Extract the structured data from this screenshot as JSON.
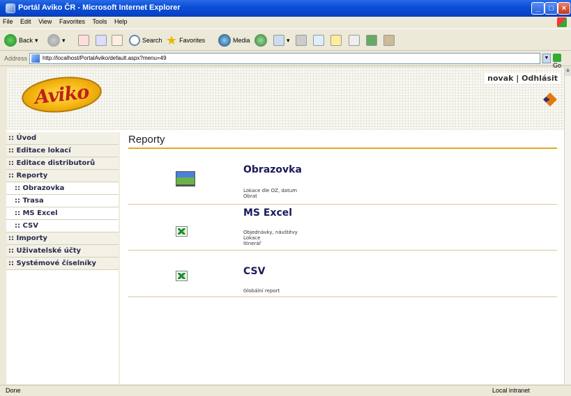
{
  "window": {
    "title": "Portál Aviko ČR - Microsoft Internet Explorer"
  },
  "menu": [
    "File",
    "Edit",
    "View",
    "Favorites",
    "Tools",
    "Help"
  ],
  "toolbar": {
    "back": "Back",
    "search": "Search",
    "favorites": "Favorites",
    "media": "Media"
  },
  "address": {
    "label": "Address",
    "url": "http://localhost/PortalAviko/default.aspx?menu=49",
    "go": "Go"
  },
  "header": {
    "logo_text": "Aviko",
    "user": "novak",
    "separator": "|",
    "logout": "Odhlásit"
  },
  "sidebar": {
    "items": [
      {
        "label": ":: Úvod"
      },
      {
        "label": ":: Editace lokací"
      },
      {
        "label": ":: Editace distributorů"
      },
      {
        "label": ":: Reporty"
      },
      {
        "label": ":: Obrazovka"
      },
      {
        "label": ":: Trasa"
      },
      {
        "label": ":: MS Excel"
      },
      {
        "label": ":: CSV"
      },
      {
        "label": ":: Importy"
      },
      {
        "label": ":: Uživatelské účty"
      },
      {
        "label": ":: Systémové číselníky"
      }
    ]
  },
  "main": {
    "title": "Reporty",
    "reports": [
      {
        "title": "Obrazovka",
        "lines": [
          "Lokace dle OZ, datum",
          "Obrat"
        ],
        "icon": "screen-icon"
      },
      {
        "title": "MS Excel",
        "lines": [
          "Objednávky, návštěvy",
          "Lokace",
          "Itinerář"
        ],
        "icon": "excel-icon"
      },
      {
        "title": "CSV",
        "lines": [
          "Globální report"
        ],
        "icon": "excel-icon"
      }
    ]
  },
  "status": {
    "left": "Done",
    "zone": "Local intranet"
  },
  "colors": {
    "accent": "#e3a91e",
    "nav_text": "#2a2a4a",
    "title_text": "#1a1a5a"
  }
}
